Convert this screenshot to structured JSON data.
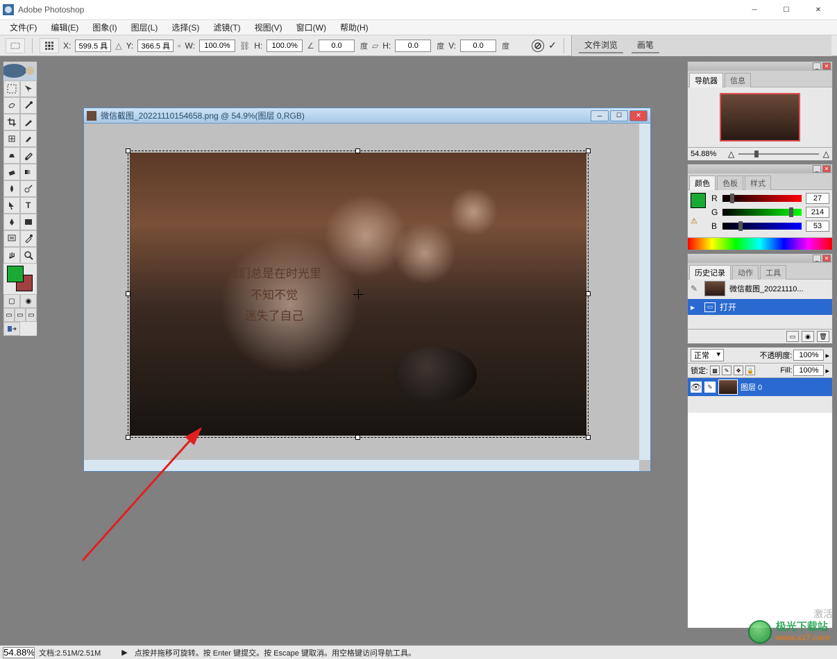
{
  "app": {
    "title": "Adobe Photoshop"
  },
  "menu": {
    "items": [
      "文件(F)",
      "编辑(E)",
      "图象(I)",
      "图层(L)",
      "选择(S)",
      "滤镜(T)",
      "视图(V)",
      "窗口(W)",
      "帮助(H)"
    ]
  },
  "optionsbar": {
    "x_label": "X:",
    "x_value": "599.5 具",
    "y_label": "Y:",
    "y_value": "366.5 具",
    "w_label": "W:",
    "w_value": "100.0%",
    "h_label": "H:",
    "h_value": "100.0%",
    "angle_value": "0.0",
    "angle_unit": "度",
    "hskew_label": "H:",
    "hskew_value": "0.0",
    "hskew_unit": "度",
    "vskew_label": "V:",
    "vskew_value": "0.0",
    "vskew_unit": "度",
    "docked_tabs": [
      "文件浏览",
      "画笔"
    ]
  },
  "toolbox": {
    "fg_color": "#1ba935",
    "bg_color": "#a04040"
  },
  "document": {
    "title": "微信截图_20221110154658.png @ 54.9%(图层 0,RGB)",
    "poem_line1": "我们总是在时光里",
    "poem_line2": "不知不觉",
    "poem_line3": "迷失了自己"
  },
  "navigator": {
    "tabs": [
      "导航器",
      "信息"
    ],
    "zoom": "54.88%"
  },
  "colorpanel": {
    "tabs": [
      "颜色",
      "色板",
      "样式"
    ],
    "r_label": "R",
    "r_value": "27",
    "g_label": "G",
    "g_value": "214",
    "b_label": "B",
    "b_value": "53",
    "warn_icon": "⚠"
  },
  "historypanel": {
    "tabs": [
      "历史记录",
      "动作",
      "工具"
    ],
    "snapshot_name": "微信截图_20221110...",
    "state_name": "打开"
  },
  "layerspanel": {
    "blend_mode": "正常",
    "opacity_label": "不透明度:",
    "opacity_value": "100%",
    "lock_label": "锁定:",
    "fill_label": "Fill:",
    "fill_value": "100%",
    "layer_name": "图层 0"
  },
  "statusbar": {
    "zoom": "54.88%",
    "docinfo": "文档:2.51M/2.51M",
    "hint": "点按并拖移可旋转。按 Enter 键提交。按 Escape 键取消。用空格键访问导航工具。"
  },
  "watermark": {
    "line1": "极光下载站",
    "line2": "www.xz7.com"
  },
  "activation": "激活"
}
